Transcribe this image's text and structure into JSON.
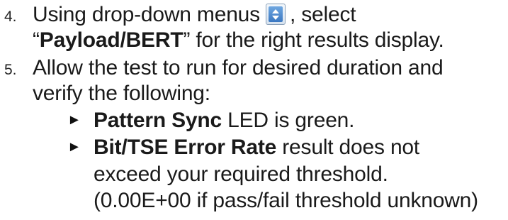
{
  "steps": [
    {
      "number": "4.",
      "lines": [
        {
          "pre": "Using drop-down menus",
          "icon": "dropdown-spinner-icon",
          "post": ", select"
        },
        {
          "quote_open": "“",
          "bold": "Payload/BERT",
          "quote_close": "”",
          "rest": " for the right results display."
        }
      ]
    },
    {
      "number": "5.",
      "lines": [
        {
          "text": "Allow the test to run for desired duration and"
        },
        {
          "text": "verify the following:"
        }
      ],
      "bullets": [
        {
          "marker": "►",
          "bold": "Pattern Sync",
          "rest": " LED is green."
        },
        {
          "marker": "►",
          "bold": "Bit/TSE Error Rate",
          "rest": " result does not",
          "continuation": [
            "exceed your required threshold.",
            "(0.00E+00 if pass/fail threshold unknown)"
          ]
        }
      ]
    }
  ]
}
